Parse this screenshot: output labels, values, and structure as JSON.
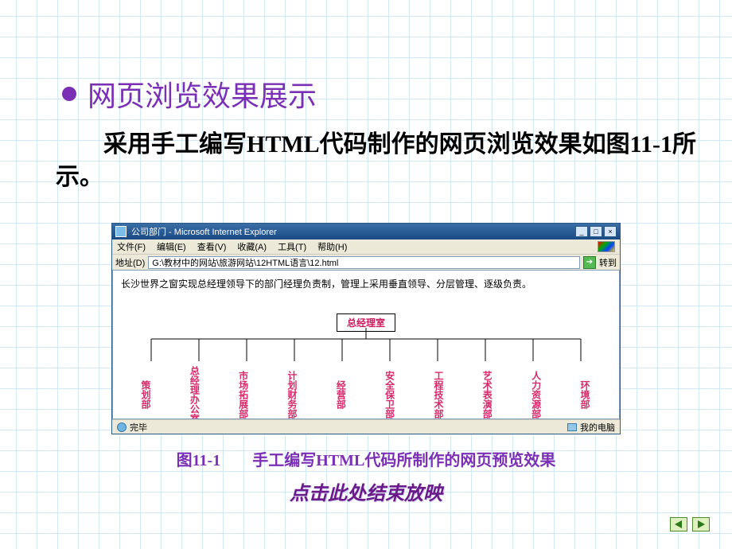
{
  "slide": {
    "title": "网页浏览效果展示",
    "paragraph": "采用手工编写HTML代码制作的网页浏览效果如图11-1所示。",
    "caption": "图11-1　　手工编写HTML代码所制作的网页预览效果",
    "footer_link": "点击此处结束放映"
  },
  "browser": {
    "window_title": "公司部门 - Microsoft Internet Explorer",
    "menu": {
      "file": "文件(F)",
      "edit": "编辑(E)",
      "view": "查看(V)",
      "favorites": "收藏(A)",
      "tools": "工具(T)",
      "help": "帮助(H)"
    },
    "address_label": "地址(D)",
    "address_value": "G:\\教材中的网站\\旅游网站\\12HTML语言\\12.html",
    "go_label": "转到",
    "status_left": "完毕",
    "status_right": "我的电脑",
    "window_buttons": {
      "min": "_",
      "max": "□",
      "close": "×"
    }
  },
  "page": {
    "intro": "长沙世界之窗实现总经理领导下的部门经理负责制，管理上采用垂直领导、分层管理、逐级负责。",
    "root": "总经理室",
    "departments": [
      "策划部",
      "总经理办公室",
      "市场拓展部",
      "计划财务部",
      "经营部",
      "安全保卫部",
      "工程技术部",
      "艺术表演部",
      "人力资源部",
      "环境部"
    ]
  }
}
